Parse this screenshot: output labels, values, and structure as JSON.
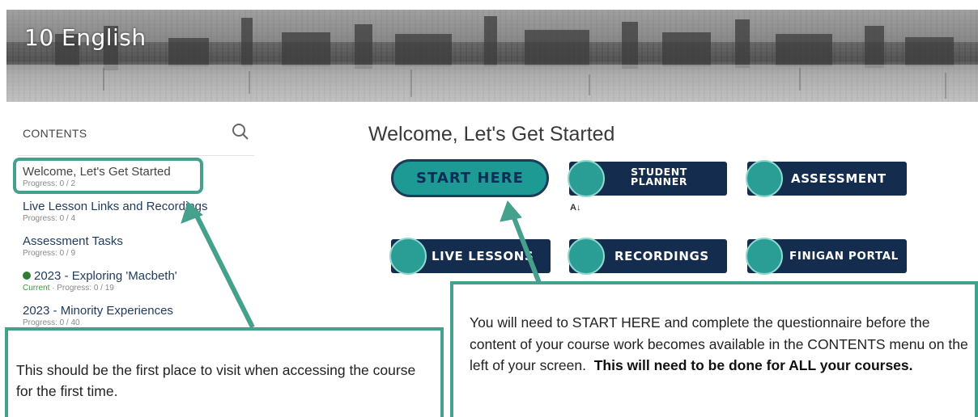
{
  "banner": {
    "title": "10 English"
  },
  "sidebar": {
    "header": "CONTENTS",
    "search_icon": "search-icon",
    "items": [
      {
        "title": "Welcome, Let's Get Started",
        "progress": "Progress: 0 / 2"
      },
      {
        "title": "Live Lesson Links and Recordings",
        "progress": "Progress: 0 / 4"
      },
      {
        "title": "Assessment Tasks",
        "progress": "Progress: 0 / 9"
      },
      {
        "title": "2023 - Exploring 'Macbeth'",
        "current": "Current",
        "sep": "·",
        "progress": "Progress: 0 / 19"
      },
      {
        "title": "2023 - Minority Experiences",
        "progress": "Progress: 0 / 40"
      }
    ]
  },
  "main": {
    "title": "Welcome, Let's Get Started",
    "tiles": {
      "start": "START HERE",
      "planner_line1": "STUDENT",
      "planner_line2": "PLANNER",
      "assessment": "ASSESSMENT",
      "live_lessons": "LIVE LESSONS",
      "recordings": "RECORDINGS",
      "finigan": "FINIGAN PORTAL"
    },
    "az_icon": "A↓"
  },
  "callouts": {
    "left": "This should be the first place to visit when accessing the course for the first time.",
    "right_plain": "You will need to START HERE and complete the questionnaire before the content of your course work becomes available in the CONTENTS menu on the left of your screen.",
    "right_bold": "This will need to be done for ALL your courses."
  },
  "colors": {
    "accent_teal": "#45a08c",
    "tile_navy": "#142d4f",
    "start_teal": "#1e9a94",
    "current_green": "#2e7d32"
  }
}
